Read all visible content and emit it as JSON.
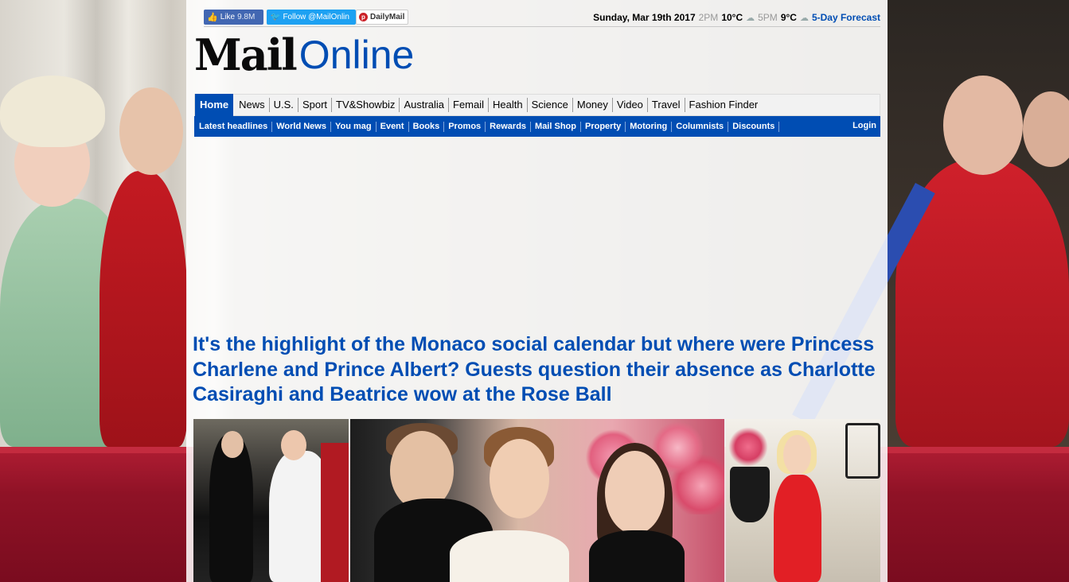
{
  "social": {
    "facebook_label": "Like",
    "facebook_count": "9.8M",
    "twitter_label": "Follow @MailOnlin",
    "pinterest_label": "DailyMail"
  },
  "weather": {
    "date": "Sunday, Mar 19th 2017",
    "time1": "2PM",
    "temp1": "10°C",
    "time2": "5PM",
    "temp2": "9°C",
    "forecast_label": "5-Day Forecast"
  },
  "logo": {
    "part1": "Mail",
    "part2": "Online"
  },
  "nav_primary": [
    {
      "label": "Home"
    },
    {
      "label": "News"
    },
    {
      "label": "U.S."
    },
    {
      "label": "Sport"
    },
    {
      "label": "TV&Showbiz"
    },
    {
      "label": "Australia"
    },
    {
      "label": "Femail"
    },
    {
      "label": "Health"
    },
    {
      "label": "Science"
    },
    {
      "label": "Money"
    },
    {
      "label": "Video"
    },
    {
      "label": "Travel"
    },
    {
      "label": "Fashion Finder"
    }
  ],
  "nav_secondary": [
    {
      "label": "Latest headlines"
    },
    {
      "label": "World News"
    },
    {
      "label": "You mag"
    },
    {
      "label": "Event"
    },
    {
      "label": "Books"
    },
    {
      "label": "Promos"
    },
    {
      "label": "Rewards"
    },
    {
      "label": "Mail Shop"
    },
    {
      "label": "Property"
    },
    {
      "label": "Motoring"
    },
    {
      "label": "Columnists"
    },
    {
      "label": "Discounts"
    }
  ],
  "login_label": "Login",
  "headline": "It's the highlight of the Monaco social calendar but where were Princess Charlene and Prince Albert? Guests question their absence as Charlotte Casiraghi and Beatrice wow at the Rose Ball",
  "colors": {
    "brand_blue": "#004db3",
    "facebook": "#4267b2",
    "twitter": "#1da1f2",
    "pinterest": "#cb2027"
  },
  "icons": {
    "facebook": "thumbs-up-icon",
    "twitter": "twitter-bird-icon",
    "pinterest": "pinterest-icon",
    "weather": "cloud-icon"
  }
}
